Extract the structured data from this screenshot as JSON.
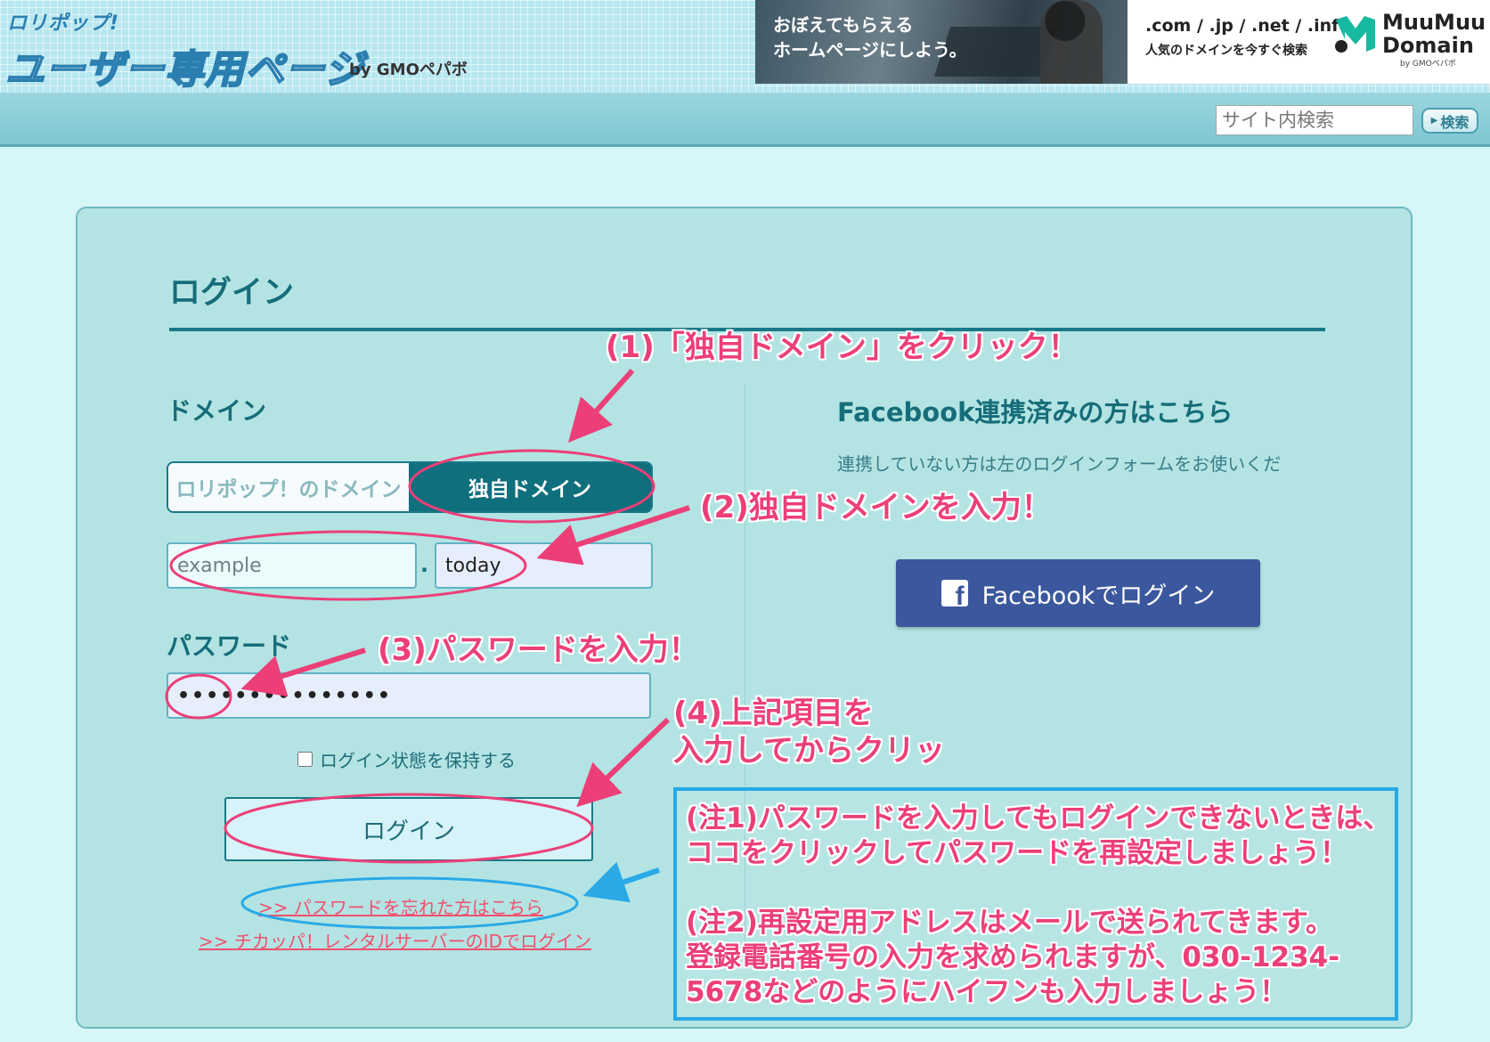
{
  "header": {
    "logo_top": "ロリポップ!",
    "logo_main": "ユーザー専用ページ",
    "logo_by": "by GMOペパボ",
    "banner_text_line1": "おぼえてもらえる",
    "banner_text_line2": "ホームページにしよう。",
    "ad_tlds": ".com / .jp / .net / .info",
    "ad_sub": "人気のドメインを今すぐ検索",
    "ad_brand_line1": "MuuMuu",
    "ad_brand_line2": "Domain",
    "ad_gmo": "by GMOペパボ",
    "search_placeholder": "サイト内検索",
    "search_button": "検索"
  },
  "login": {
    "title": "ログイン",
    "domain_label": "ドメイン",
    "toggle_lolipop": "ロリポップ！のドメイン",
    "toggle_own": "独自ドメイン",
    "domain_placeholder": "example",
    "dot": ".",
    "tld_value": "today",
    "password_label": "パスワード",
    "password_value": "password_masked",
    "keep_login": "ログイン状態を保持する",
    "login_button": "ログイン",
    "forgot_link": ">>  パスワードを忘れた方はこちら",
    "chicappa_link": ">>  チカッパ！レンタルサーバーのIDでログイン"
  },
  "facebook": {
    "heading": "Facebook連携済みの方はこちら",
    "description": "連携していない方は左のログインフォームをお使いくだ",
    "button_label": "Facebookでログイン",
    "icon_letter": "f"
  },
  "annotations": {
    "step1": "(1)「独自ドメイン」をクリック！",
    "step2": "(2)独自ドメインを入力！",
    "step3": "(3)パスワードを入力！",
    "step4_line1": "(4)上記項目を",
    "step4_line2": "入力してからクリッ",
    "note1_line1": "(注1)パスワードを入力してもログインできないときは、",
    "note1_line2": "ココをクリックしてパスワードを再設定しましょう！",
    "note2_line1": "(注2)再設定用アドレスはメールで送られてきます。",
    "note2_line2": "登録電話番号の入力を求められますが、030-1234-",
    "note2_line3": "5678などのようにハイフンも入力しましょう！"
  },
  "colors": {
    "accent_teal": "#197988",
    "annotation_pink": "#ec3f78",
    "annotation_blue": "#29a9e6",
    "facebook_blue": "#3b579d"
  }
}
